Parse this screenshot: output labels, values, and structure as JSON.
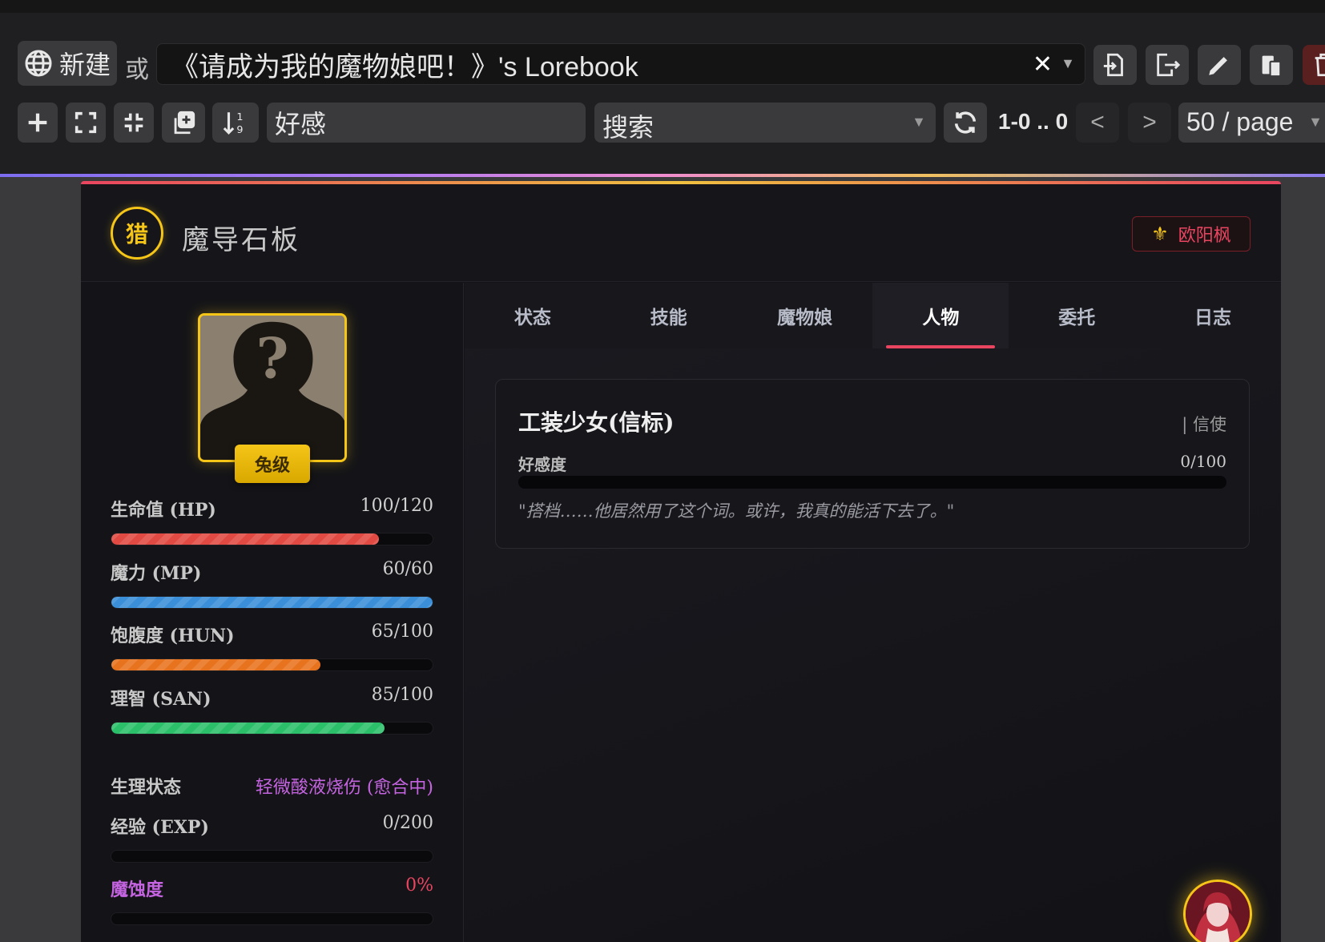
{
  "toolbar": {
    "new_label": "新建",
    "or_label": "或",
    "lorebook_name": "《请成为我的魔物娘吧！》's Lorebook",
    "filter_value": "好感",
    "search_label": "搜索",
    "range_text": "1-0 .. 0",
    "prev_label": "<",
    "next_label": ">",
    "per_page": "50 / page"
  },
  "header": {
    "rank_char": "猎",
    "title": "魔导石板",
    "player_name": "欧阳枫",
    "player_icon": "fleur-de-lis-icon"
  },
  "profile": {
    "rank_tag": "兔级",
    "portrait_icon": "unknown-silhouette-icon"
  },
  "stats": {
    "hp": {
      "label": "生命值 (HP)",
      "value": "100/120",
      "fraction": 0.833
    },
    "mp": {
      "label": "魔力 (MP)",
      "value": "60/60",
      "fraction": 1.0
    },
    "hun": {
      "label": "饱腹度 (HUN)",
      "value": "65/100",
      "fraction": 0.65
    },
    "san": {
      "label": "理智 (SAN)",
      "value": "85/100",
      "fraction": 0.85
    },
    "condition": {
      "label": "生理状态",
      "value": "轻微酸液烧伤 (愈合中)"
    },
    "exp": {
      "label": "经验 (EXP)",
      "value": "0/200",
      "fraction": 0
    },
    "corruption": {
      "label": "魔蚀度",
      "value": "0%",
      "fraction": 0
    }
  },
  "tabs": [
    {
      "label": "状态",
      "active": false
    },
    {
      "label": "技能",
      "active": false
    },
    {
      "label": "魔物娘",
      "active": false
    },
    {
      "label": "人物",
      "active": true
    },
    {
      "label": "委托",
      "active": false
    },
    {
      "label": "日志",
      "active": false
    }
  ],
  "npc": {
    "name": "工装少女(信标)",
    "role": "| 信使",
    "affection_label": "好感度",
    "affection_value": "0/100",
    "affection_fraction": 0,
    "quote": "\"搭档……他居然用了这个词。或许，我真的能活下去了。\""
  },
  "colors": {
    "accent_gold": "#f5c518",
    "accent_red": "#e94560",
    "hp": "#e04a42",
    "mp": "#3a8fd8",
    "hun": "#e8731e",
    "san": "#2bbf6a",
    "condition": "#c564e0"
  }
}
